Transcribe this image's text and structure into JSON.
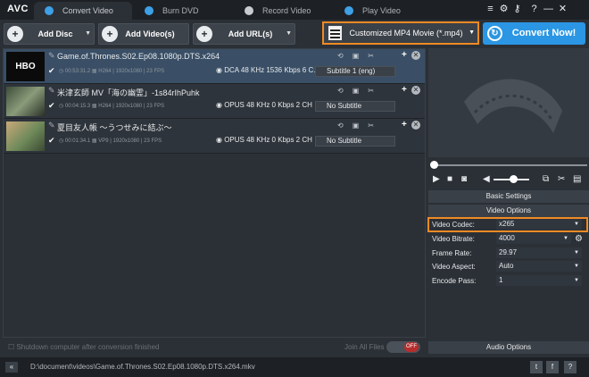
{
  "app": {
    "logo": "AVC"
  },
  "tabs": [
    {
      "label": "Convert Video"
    },
    {
      "label": "Burn DVD"
    },
    {
      "label": "Record Video"
    },
    {
      "label": "Play Video"
    }
  ],
  "window": {
    "menu_icon": "≡",
    "gear_icon": "⚙",
    "key_icon": "⚷",
    "help_icon": "?",
    "minimize": "—",
    "close": "✕"
  },
  "toolbar": {
    "add_disc": "Add Disc",
    "add_videos": "Add Video(s)",
    "add_urls": "Add URL(s)",
    "profile": "Customized MP4 Movie (*.mp4)",
    "convert": "Convert Now!"
  },
  "files": [
    {
      "name": "Game.of.Thrones.S02.Ep08.1080p.DTS.x264",
      "duration": "00:53:31.2",
      "video": "H264 | 1920x1080 | 23 FPS",
      "audio": "DCA 48 KHz 1536 Kbps 6 C…",
      "subtitle": "Subtitle 1 (eng)",
      "thumb_text": "HBO"
    },
    {
      "name": "米津玄師 MV「海の幽霊」-1s84rIhPuhk",
      "duration": "00:04:15.3",
      "video": "H264 | 1920x1080 | 23 FPS",
      "audio": "OPUS 48 KHz 0 Kbps 2 CH …",
      "subtitle": "No Subtitle",
      "thumb_text": ""
    },
    {
      "name": "夏目友人帳 ～うつせみに結ぶ～",
      "duration": "00:01:34.1",
      "video": "VP9 | 1920x1080 | 23 FPS",
      "audio": "OPUS 48 KHz 0 Kbps 2 CH …",
      "subtitle": "No Subtitle",
      "thumb_text": ""
    }
  ],
  "bottom": {
    "shutdown": "Shutdown computer after conversion finished",
    "join_all": "Join All Files",
    "join_toggle": "OFF"
  },
  "settings": {
    "basic": "Basic Settings",
    "video_options": "Video Options",
    "audio_options": "Audio Options",
    "options": [
      {
        "key": "Video Codec:",
        "value": "x265"
      },
      {
        "key": "Video Bitrate:",
        "value": "4000"
      },
      {
        "key": "Frame Rate:",
        "value": "29.97"
      },
      {
        "key": "Video Aspect:",
        "value": "Auto"
      },
      {
        "key": "Encode Pass:",
        "value": "1"
      }
    ]
  },
  "player": {
    "scrub_fraction": 0.0,
    "volume_fraction": 0.55
  },
  "status": {
    "path": "D:\\document\\videos\\Game.of.Thrones.S02.Ep08.1080p.DTS.x264.mkv",
    "twitter": "t",
    "facebook": "f",
    "help": "?"
  },
  "colors": {
    "accent": "#2b96e3",
    "highlight": "#f08a24",
    "selected_row": "#3a4f66"
  }
}
